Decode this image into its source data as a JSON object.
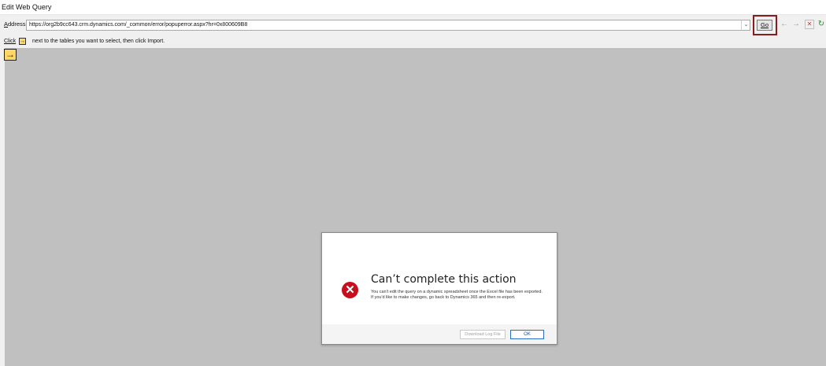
{
  "window": {
    "title": "Edit Web Query"
  },
  "address_bar": {
    "label_prefix": "",
    "label_underlined": "A",
    "label_rest": "ddress:",
    "url": "https://org2b9cc643.crm.dynamics.com/_common/error/popuperror.aspx?hr=0x800609B8",
    "dropdown_glyph": "⌄",
    "go_label": "Go"
  },
  "toolbar": {
    "back_glyph": "←",
    "forward_glyph": "→",
    "stop_glyph": "✕",
    "refresh_glyph": "↻"
  },
  "instruction": {
    "click_label": "Click",
    "arrow_glyph": "→",
    "text": "next to the tables you want to select, then click Import."
  },
  "table_selector": {
    "arrow_glyph": "→"
  },
  "dialog": {
    "icon_glyph": "✕",
    "title": "Can’t complete this action",
    "message": "You can't edit the query on a dynamic spreadsheet once the Excel file has been exported. If you'd like to make changes, go back to Dynamics 365 and then re-export.",
    "download_log_label": "Download Log File",
    "ok_label": "OK"
  },
  "colors": {
    "highlight_border": "#8b1a1a",
    "content_background": "#c0c0c0",
    "error_icon": "#c50f1f",
    "ok_border": "#2b6cc4",
    "table_arrow_fill": "#ffd766"
  }
}
